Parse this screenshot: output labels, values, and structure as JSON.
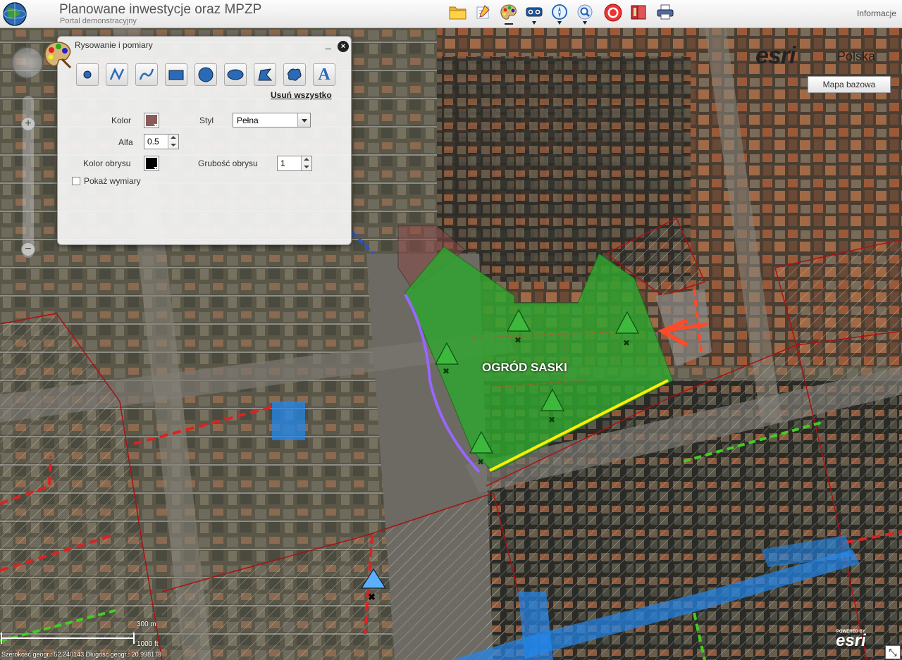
{
  "app": {
    "title": "Planowane inwestycje oraz MPZP",
    "subtitle": "Portal demonstracyjny",
    "info_link": "Informacje"
  },
  "toolbar": {
    "buttons": [
      "folder-icon",
      "notes-icon",
      "palette-icon",
      "binoculars-icon",
      "compass-icon",
      "zoom-search-icon",
      "target-icon",
      "book-icon",
      "printer-icon"
    ]
  },
  "drawing_panel": {
    "title": "Rysowanie i pomiary",
    "minimize_label": "_",
    "close_label": "×",
    "tools": [
      "point",
      "polyline",
      "freehand-line",
      "rectangle",
      "circle",
      "ellipse",
      "polygon",
      "freehand-polygon",
      "text"
    ],
    "text_tool_glyph": "A",
    "clear_all": "Usuń wszystko",
    "fill_color_label": "Kolor",
    "fill_color": "#8b5a5a",
    "style_label": "Styl",
    "style_value": "Pełna",
    "alpha_label": "Alfa",
    "alpha_value": "0.5",
    "outline_color_label": "Kolor obrysu",
    "outline_color": "#000000",
    "outline_width_label": "Grubość obrysu",
    "outline_width_value": "1",
    "show_dims_label": "Pokaż wymiary",
    "show_dims_checked": false
  },
  "map": {
    "basemap_button": "Mapa bazowa",
    "esri_logo": "esri",
    "esri_logo_sub": "Polska",
    "area_label": "OGRÓD SASKI",
    "scale_m": "300 m",
    "scale_ft": "1000 ft",
    "coords": "Szerokość geogr.: 52.240143   Długość geogr.: 20.998179",
    "powered_by": "POWERED BY",
    "powered_logo": "esri",
    "colors": {
      "park_fill": "#2fa62f",
      "purple_line": "#9966ff",
      "yellow_line": "#ffee00",
      "red_dashed": "#dd2222",
      "green_dashed": "#44cc22",
      "blue_corridor": "#2288ee",
      "plan_boundary": "#aa1111"
    }
  }
}
